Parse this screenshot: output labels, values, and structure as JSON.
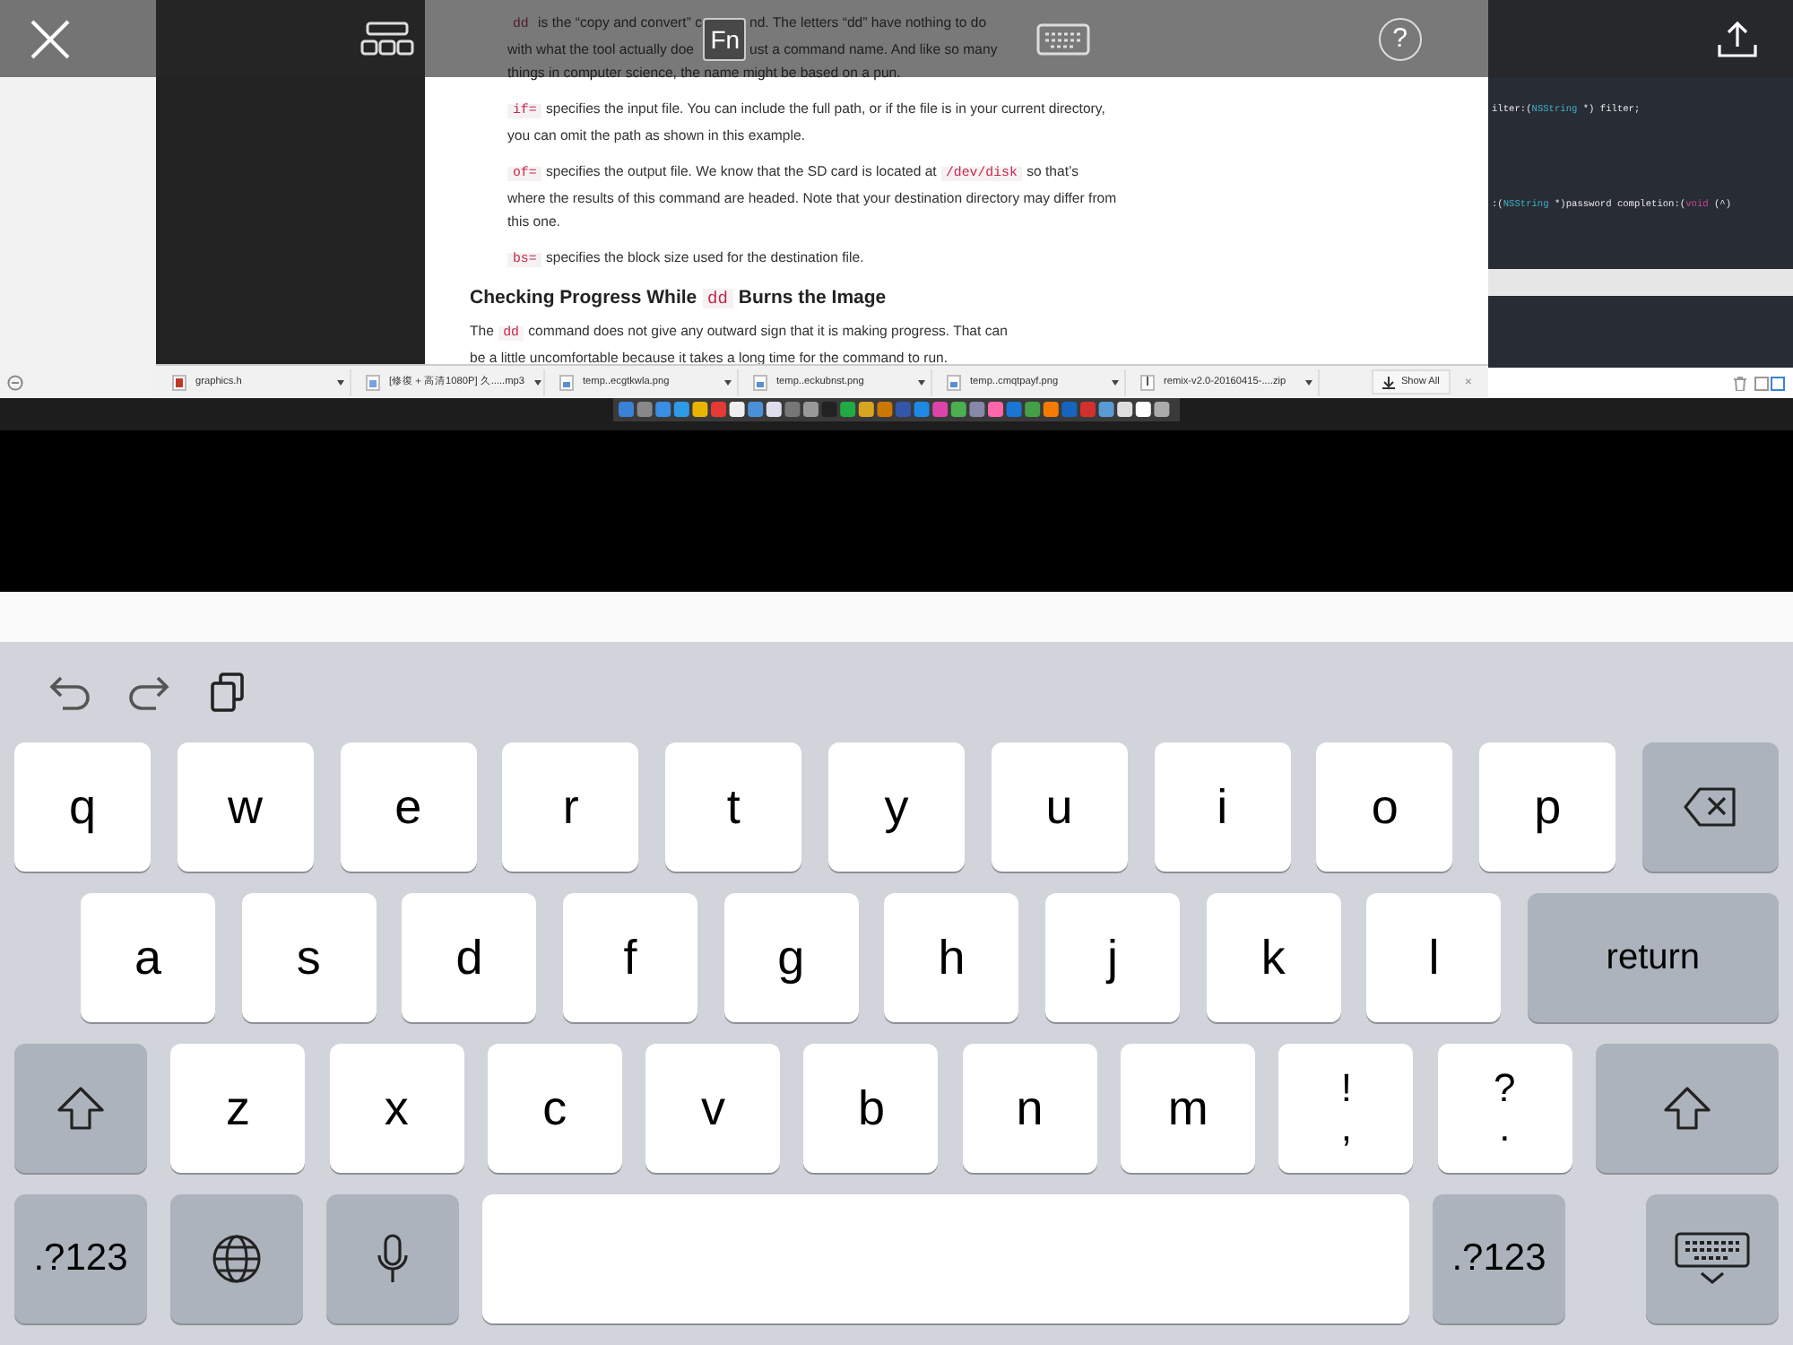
{
  "toolbar": [
    {
      "kind": "close"
    },
    {
      "kind": "layout"
    },
    {
      "kind": "fn",
      "label": "Fn"
    },
    {
      "kind": "keyboard"
    },
    {
      "kind": "help",
      "label": "?"
    },
    {
      "kind": "upload"
    }
  ],
  "article": {
    "bullets": [
      {
        "kind": "split",
        "lines": [
          {
            "left": [
              {
                "kind": "code",
                "text": "dd"
              },
              {
                "kind": "text",
                "text": " is the “copy and convert” c"
              }
            ],
            "right": [
              {
                "kind": "text",
                "text": "nd. The letters “dd” have nothing to do"
              }
            ]
          },
          {
            "left": [
              {
                "kind": "text",
                "text": "with what the tool actually doe"
              }
            ],
            "right": [
              {
                "kind": "text",
                "text": "ust a command name. And like so many"
              }
            ]
          },
          {
            "left": [
              {
                "kind": "text",
                "text": "things in computer science, the name might be based on a pun."
              }
            ]
          }
        ]
      },
      {
        "kind": "flow",
        "parts": [
          {
            "kind": "code",
            "text": "if="
          },
          {
            "kind": "text",
            "text": " specifies the input file. You can include the full path, or if the file is in your current directory, you can omit the path as shown in this example."
          }
        ]
      },
      {
        "kind": "flow",
        "parts": [
          {
            "kind": "code",
            "text": "of="
          },
          {
            "kind": "text",
            "text": " specifies the output file. We know that the SD card is located at "
          },
          {
            "kind": "code",
            "text": "/dev/disk"
          },
          {
            "kind": "text",
            "text": " so that’s where the results of this command are headed. Note that your destination directory may differ from this one."
          }
        ]
      },
      {
        "kind": "flow",
        "parts": [
          {
            "kind": "code",
            "text": "bs="
          },
          {
            "kind": "text",
            "text": " specifies the block size used for the destination file."
          }
        ]
      }
    ],
    "heading": [
      {
        "kind": "text",
        "text": "Checking Progress While "
      },
      {
        "kind": "code",
        "text": "dd"
      },
      {
        "kind": "text",
        "text": " Burns the Image"
      }
    ],
    "paragraph": [
      {
        "kind": "text",
        "text": "The "
      },
      {
        "kind": "code",
        "text": "dd"
      },
      {
        "kind": "text",
        "text": " command does not give any outward sign that it is making progress. That can be a little uncomfortable because it takes a long time for the command to run."
      }
    ]
  },
  "downloads": {
    "items": [
      {
        "kind": "source",
        "name": "graphics.h"
      },
      {
        "kind": "audio",
        "name": "[修復＋高清1080P] 久.....mp3"
      },
      {
        "kind": "image",
        "name": "temp..ecgtkwla.png"
      },
      {
        "kind": "image",
        "name": "temp..eckubnst.png"
      },
      {
        "kind": "image",
        "name": "temp..cmqtpayf.png"
      },
      {
        "kind": "archive",
        "name": "remix-v2.0-20160415-....zip"
      }
    ],
    "show_all": "Show All",
    "close": "×"
  },
  "code_editor": {
    "lines": [
      [
        {
          "kind": "plain",
          "text": "ilter:("
        },
        {
          "kind": "type",
          "text": "NSString"
        },
        {
          "kind": "plain",
          "text": " *) filter;"
        }
      ],
      [
        {
          "kind": "plain",
          "text": ":("
        },
        {
          "kind": "type",
          "text": "NSString"
        },
        {
          "kind": "plain",
          "text": " *)password completion:("
        },
        {
          "kind": "keyword",
          "text": "void"
        },
        {
          "kind": "plain",
          "text": " (^)"
        }
      ]
    ]
  },
  "keyboard": {
    "tools": [
      {
        "kind": "undo"
      },
      {
        "kind": "redo"
      },
      {
        "kind": "paste"
      }
    ],
    "rows": [
      [
        {
          "kind": "letter",
          "label": "q"
        },
        {
          "kind": "letter",
          "label": "w"
        },
        {
          "kind": "letter",
          "label": "e"
        },
        {
          "kind": "letter",
          "label": "r"
        },
        {
          "kind": "letter",
          "label": "t"
        },
        {
          "kind": "letter",
          "label": "y"
        },
        {
          "kind": "letter",
          "label": "u"
        },
        {
          "kind": "letter",
          "label": "i"
        },
        {
          "kind": "letter",
          "label": "o"
        },
        {
          "kind": "letter",
          "label": "p"
        },
        {
          "kind": "backspace"
        }
      ],
      [
        {
          "kind": "letter",
          "label": "a"
        },
        {
          "kind": "letter",
          "label": "s"
        },
        {
          "kind": "letter",
          "label": "d"
        },
        {
          "kind": "letter",
          "label": "f"
        },
        {
          "kind": "letter",
          "label": "g"
        },
        {
          "kind": "letter",
          "label": "h"
        },
        {
          "kind": "letter",
          "label": "j"
        },
        {
          "kind": "letter",
          "label": "k"
        },
        {
          "kind": "letter",
          "label": "l"
        },
        {
          "kind": "return",
          "label": "return"
        }
      ],
      [
        {
          "kind": "shift"
        },
        {
          "kind": "letter",
          "label": "z"
        },
        {
          "kind": "letter",
          "label": "x"
        },
        {
          "kind": "letter",
          "label": "c"
        },
        {
          "kind": "letter",
          "label": "v"
        },
        {
          "kind": "letter",
          "label": "b"
        },
        {
          "kind": "letter",
          "label": "n"
        },
        {
          "kind": "letter",
          "label": "m"
        },
        {
          "kind": "dual",
          "label": "!",
          "label2": ","
        },
        {
          "kind": "dual",
          "label": "?",
          "label2": "."
        },
        {
          "kind": "shift"
        }
      ],
      [
        {
          "kind": "numbers",
          "label": ".?123"
        },
        {
          "kind": "globe"
        },
        {
          "kind": "mic"
        },
        {
          "kind": "space"
        },
        {
          "kind": "numbers",
          "label": ".?123"
        },
        {
          "kind": "hide"
        }
      ]
    ]
  }
}
